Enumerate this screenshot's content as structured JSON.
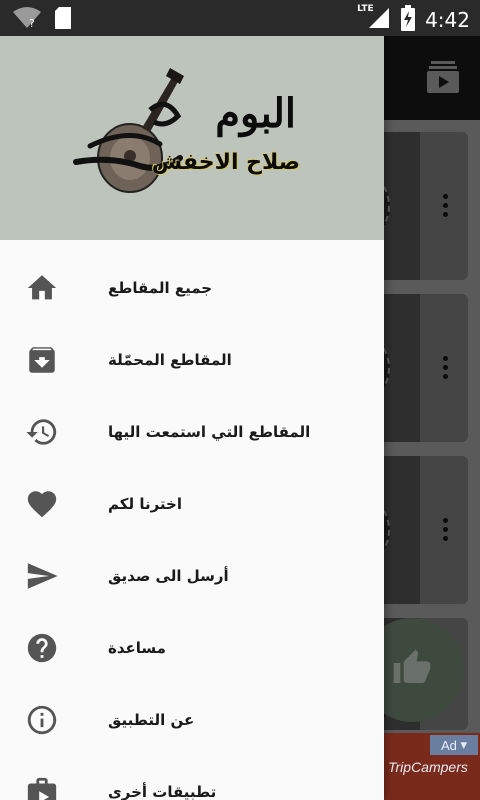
{
  "status_bar": {
    "time": "4:42",
    "network": "LTE",
    "icons": [
      "wifi-question-icon",
      "sd-card-icon",
      "signal-icon",
      "battery-charging-icon"
    ]
  },
  "drawer": {
    "header": {
      "title": "البوم",
      "subtitle": "صلاح الاخفش",
      "logo_icon": "oud-logo-icon"
    },
    "menu_items": [
      {
        "label": "جميع المقاطع",
        "icon": "home-icon"
      },
      {
        "label": "المقاطع المحمّلة",
        "icon": "download-box-icon"
      },
      {
        "label": "المقاطع التي استمعت اليها",
        "icon": "history-icon"
      },
      {
        "label": "اخترنا لكم",
        "icon": "heart-icon"
      },
      {
        "label": "أرسل الى صديق",
        "icon": "send-icon"
      },
      {
        "label": "مساعدة",
        "icon": "help-icon"
      },
      {
        "label": "عن التطبيق",
        "icon": "info-icon"
      },
      {
        "label": "تطبيقات أخرى",
        "icon": "store-icon"
      }
    ]
  },
  "background": {
    "toolbar_icon": "video-library-icon",
    "fab_icon": "thumbs-up-icon",
    "ad": {
      "badge": "Ad",
      "brand": "TripCampers"
    }
  },
  "colors": {
    "drawer_header_bg": "#bcc4bb",
    "drawer_bg": "#fafafa",
    "icon_color": "#555555",
    "status_bar_bg": "#2a2a2a"
  }
}
